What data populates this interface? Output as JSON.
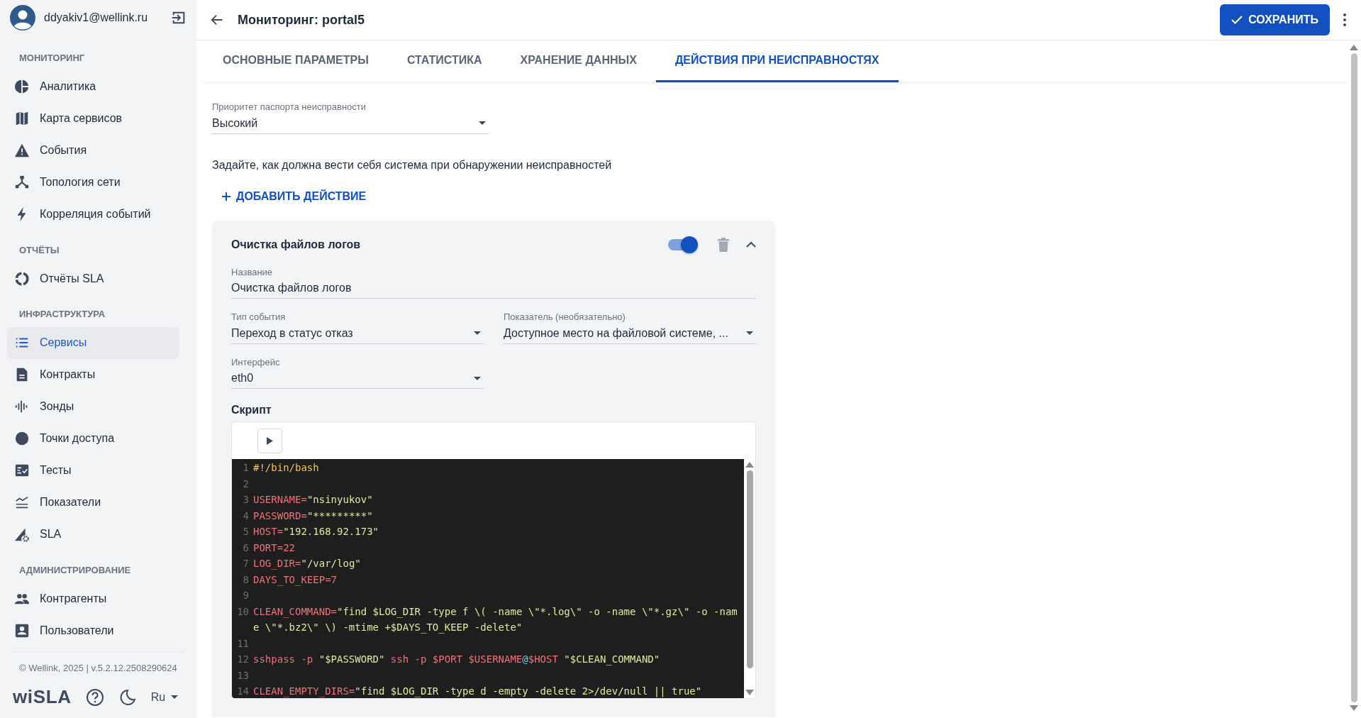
{
  "user": {
    "email": "ddyakiv1@wellink.ru"
  },
  "sidebar": [
    {
      "title": "МОНИТОРИНГ",
      "items": [
        {
          "label": "Аналитика",
          "selected": false
        },
        {
          "label": "Карта сервисов",
          "selected": false
        },
        {
          "label": "События",
          "selected": false
        },
        {
          "label": "Топология сети",
          "selected": false
        },
        {
          "label": "Корреляция событий",
          "selected": false
        }
      ]
    },
    {
      "title": "ОТЧЁТЫ",
      "items": [
        {
          "label": "Отчёты SLA",
          "selected": false
        }
      ]
    },
    {
      "title": "ИНФРАСТРУКТУРА",
      "items": [
        {
          "label": "Сервисы",
          "selected": true
        },
        {
          "label": "Контракты",
          "selected": false
        },
        {
          "label": "Зонды",
          "selected": false
        },
        {
          "label": "Точки доступа",
          "selected": false
        },
        {
          "label": "Тесты",
          "selected": false
        },
        {
          "label": "Показатели",
          "selected": false
        },
        {
          "label": "SLA",
          "selected": false
        }
      ]
    },
    {
      "title": "АДМИНИСТРИРОВАНИЕ",
      "items": [
        {
          "label": "Контрагенты",
          "selected": false
        },
        {
          "label": "Пользователи",
          "selected": false
        }
      ]
    }
  ],
  "footer": {
    "copyright": "© Wellink, 2025 | v.5.2.12.2508290624",
    "logo": "wiSLA",
    "language": "Ru"
  },
  "header": {
    "title": "Мониторинг: portal5",
    "save": "СОХРАНИТЬ"
  },
  "tabs": [
    {
      "label": "ОСНОВНЫЕ ПАРАМЕТРЫ",
      "selected": false
    },
    {
      "label": "СТАТИСТИКА",
      "selected": false
    },
    {
      "label": "ХРАНЕНИЕ ДАННЫХ",
      "selected": false
    },
    {
      "label": "ДЕЙСТВИЯ ПРИ НЕИСПРАВНОСТЯХ",
      "selected": true
    }
  ],
  "priority": {
    "label": "Приоритет паспорта неисправности",
    "value": "Высокий"
  },
  "description": "Задайте, как должна вести себя система при обнаружении неисправностей",
  "add_action": "ДОБАВИТЬ ДЕЙСТВИЕ",
  "action": {
    "title": "Очистка файлов логов",
    "on": true,
    "expanded": true,
    "name": {
      "label": "Название",
      "value": "Очистка файлов логов"
    },
    "event_type": {
      "label": "Тип события",
      "value": "Переход в статус отказ"
    },
    "metric": {
      "label": "Показатель (необязательно)",
      "value": "Доступное место на файловой системе, ..."
    },
    "interface": {
      "label": "Интерфейс",
      "value": "eth0"
    },
    "script_label": "Скрипт",
    "code": [
      {
        "number": "1",
        "tokens": [
          {
            "kind": "comment",
            "text": "#!/bin/bash"
          }
        ]
      },
      {
        "number": "2"
      },
      {
        "number": "3",
        "tokens": [
          {
            "kind": "var",
            "text": "USERNAME"
          },
          {
            "kind": "op",
            "text": "="
          },
          {
            "kind": "str",
            "text": "\"nsinyukov\""
          }
        ]
      },
      {
        "number": "4",
        "tokens": [
          {
            "kind": "var",
            "text": "PASSWORD"
          },
          {
            "kind": "op",
            "text": "="
          },
          {
            "kind": "str",
            "text": "\"*********\""
          }
        ]
      },
      {
        "number": "5",
        "tokens": [
          {
            "kind": "var",
            "text": "HOST"
          },
          {
            "kind": "op",
            "text": "="
          },
          {
            "kind": "str",
            "text": "\"192.168.92.173\""
          }
        ]
      },
      {
        "number": "6",
        "tokens": [
          {
            "kind": "var",
            "text": "PORT"
          },
          {
            "kind": "op",
            "text": "="
          },
          {
            "kind": "num",
            "text": "22"
          }
        ]
      },
      {
        "number": "7",
        "tokens": [
          {
            "kind": "var",
            "text": "LOG_DIR"
          },
          {
            "kind": "op",
            "text": "="
          },
          {
            "kind": "str",
            "text": "\"/var/log\""
          }
        ]
      },
      {
        "number": "8",
        "tokens": [
          {
            "kind": "var",
            "text": "DAYS_TO_KEEP"
          },
          {
            "kind": "op",
            "text": "="
          },
          {
            "kind": "num",
            "text": "7"
          }
        ]
      },
      {
        "number": "9"
      },
      {
        "number": "10",
        "tokens": [
          {
            "kind": "var",
            "text": "CLEAN_COMMAND"
          },
          {
            "kind": "op",
            "text": "="
          },
          {
            "kind": "str",
            "text": "\"find $LOG_DIR -type f \\( -name \\\"*.log\\\" -o -name \\\"*.gz\\\" -o -name \\\"*.bz2\\\" \\) -mtime +$DAYS_TO_KEEP -delete\""
          }
        ]
      },
      {
        "number": "11"
      },
      {
        "number": "12",
        "tokens": [
          {
            "kind": "var",
            "text": "sshpass -p "
          },
          {
            "kind": "str",
            "text": "\"$PASSWORD\""
          },
          {
            "kind": "var",
            "text": " ssh -p $PORT $USERNAME"
          },
          {
            "kind": "at",
            "text": "@"
          },
          {
            "kind": "var",
            "text": "$HOST "
          },
          {
            "kind": "str",
            "text": "\"$CLEAN_COMMAND\""
          }
        ]
      },
      {
        "number": "13"
      },
      {
        "number": "14",
        "tokens": [
          {
            "kind": "var",
            "text": "CLEAN_EMPTY_DIRS"
          },
          {
            "kind": "op",
            "text": "="
          },
          {
            "kind": "str",
            "text": "\"find $LOG_DIR -type d -empty -delete 2>/dev/null || true\""
          }
        ]
      }
    ]
  }
}
